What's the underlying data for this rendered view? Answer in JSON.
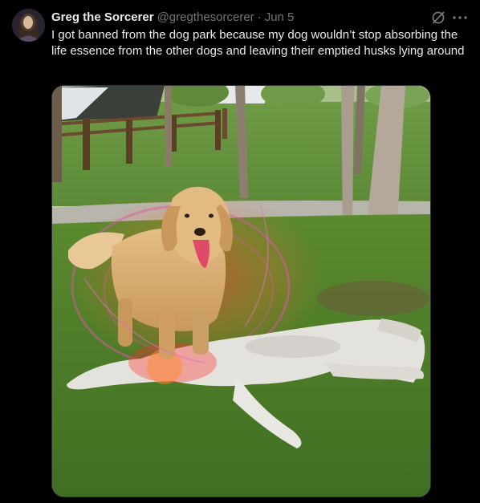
{
  "post": {
    "author_name": "Greg the Sorcerer",
    "author_handle": "@gregthesorcerer",
    "separator": "·",
    "date": "Jun 5",
    "text": "I got banned from the dog park because my dog wouldn’t stop absorbing the life essence from the other dogs and leaving their emptied husks lying around"
  },
  "icons": {
    "grok": "grok-icon",
    "more": "more-horizontal-icon",
    "avatar": "avatar"
  },
  "colors": {
    "background": "#000000",
    "text": "#e7e9ea",
    "secondary": "#71767b",
    "border": "#2f3336"
  }
}
